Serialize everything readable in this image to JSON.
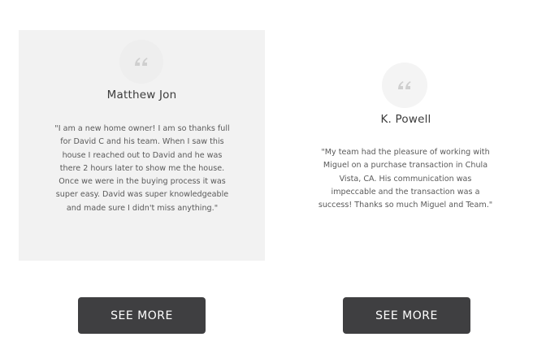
{
  "testimonials": [
    {
      "name": "Matthew Jon",
      "quote": "\"I am a new home owner! I am so thanks full for David C and his team. When I saw this house I reached out to David and he was there 2 hours later to show me the house. Once we were in the buying process it was super easy. David was super knowledgeable and made sure I didn't miss anything.\"",
      "quote_icon": "quote-icon",
      "button_label": "SEE MORE"
    },
    {
      "name": "K. Powell",
      "quote": "\"My team had the pleasure of working with Miguel on a purchase transaction in Chula Vista, CA. His communication was impeccable and the transaction was a success! Thanks so much Miguel and Team.\"",
      "quote_icon": "quote-icon",
      "button_label": "SEE MORE"
    }
  ],
  "colors": {
    "card_background": "#f2f2f2",
    "button_background": "#3f3f41",
    "button_text": "#ffffff",
    "name_text": "#3c3c3c",
    "quote_text": "#5a5a5a"
  }
}
